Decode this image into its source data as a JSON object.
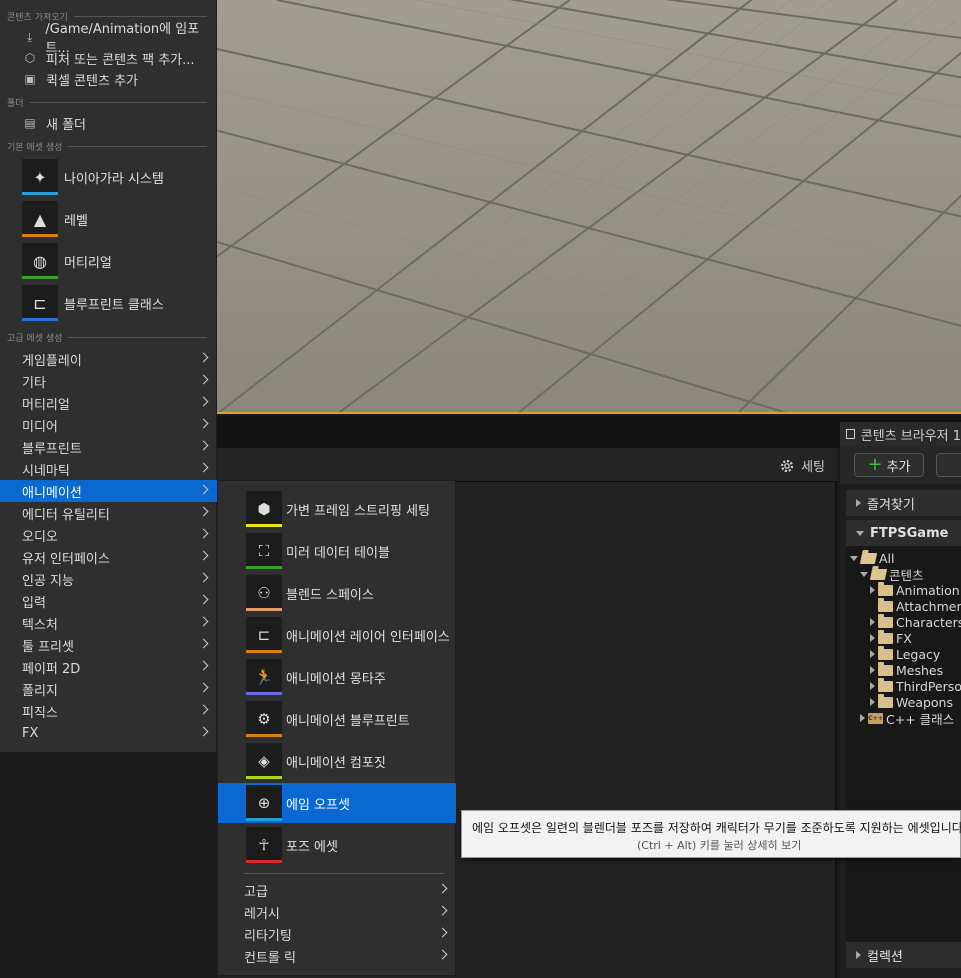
{
  "left_menu": {
    "sections": {
      "import": "콘텐츠 가져오기",
      "folder": "폴더",
      "basic": "기본 에셋 생성",
      "advanced": "고급 에셋 생성"
    },
    "import_items": [
      {
        "label": "/Game/Animation에 임포트...",
        "icon": "import-icon"
      },
      {
        "label": "피처 또는 콘텐츠 팩 추가...",
        "icon": "feature-pack-icon"
      },
      {
        "label": "퀵셀 콘텐츠 추가",
        "icon": "quixel-icon"
      }
    ],
    "folder_item": {
      "label": "새 폴더",
      "icon": "new-folder-icon"
    },
    "basic_assets": [
      {
        "label": "나이아가라 시스템",
        "icon": "niagara-icon",
        "color": "#27a0d9"
      },
      {
        "label": "레벨",
        "icon": "level-icon",
        "color": "#d97f10"
      },
      {
        "label": "머티리얼",
        "icon": "material-icon",
        "color": "#3b9f2d"
      },
      {
        "label": "블루프린트 클래스",
        "icon": "blueprint-icon",
        "color": "#2a6fd6"
      }
    ],
    "categories": [
      "게임플레이",
      "기타",
      "머티리얼",
      "미디어",
      "블루프린트",
      "시네마틱",
      "애니메이션",
      "에디터 유틸리티",
      "오디오",
      "유저 인터페이스",
      "인공 지능",
      "입력",
      "텍스처",
      "툴 프리셋",
      "페이퍼 2D",
      "폴리지",
      "피직스",
      "FX"
    ],
    "active_category": "애니메이션"
  },
  "submenu": {
    "assets": [
      {
        "label": "가변 프레임 스트리핑 세팅",
        "icon": "cube-icon",
        "color": "#e6e61a"
      },
      {
        "label": "미러 데이터 테이블",
        "icon": "mirror-icon",
        "color": "#3b9f2d"
      },
      {
        "label": "블렌드 스페이스",
        "icon": "blend-space-icon",
        "color": "#e89a6b"
      },
      {
        "label": "애니메이션 레이어 인터페이스",
        "icon": "layer-interface-icon",
        "color": "#d97f10"
      },
      {
        "label": "애니메이션 몽타주",
        "icon": "montage-icon",
        "color": "#6a6ae8"
      },
      {
        "label": "애니메이션 블루프린트",
        "icon": "anim-blueprint-icon",
        "color": "#d97f10"
      },
      {
        "label": "애니메이션 컴포짓",
        "icon": "composite-icon",
        "color": "#a8d81a"
      },
      {
        "label": "에임 오프셋",
        "icon": "aim-offset-icon",
        "color": "#27a0d9"
      },
      {
        "label": "포즈 에셋",
        "icon": "pose-asset-icon",
        "color": "#d62a2a"
      }
    ],
    "active_asset": "에임 오프셋",
    "categories": [
      "고급",
      "레거시",
      "리타기팅",
      "컨트롤 릭"
    ]
  },
  "tooltip": {
    "text": "에임 오프셋은 일련의 블렌더블 포즈를 저장하여 캐릭터가 무기를 조준하도록 지원하는 에셋입니다.",
    "hint": "(Ctrl + Alt) 키를 눌러 상세히 보기"
  },
  "details": {
    "settings_label": "세팅"
  },
  "content_browser": {
    "tab_label": "콘텐츠 브라우저 1",
    "add_label": "추가",
    "favorites_label": "즐겨찾기",
    "project_label": "FTPSGame",
    "collections_label": "컬렉션",
    "tree": [
      {
        "label": "All",
        "level": 0,
        "expanded": true,
        "type": "folder-open"
      },
      {
        "label": "콘텐츠",
        "level": 1,
        "expanded": true,
        "type": "folder-open"
      },
      {
        "label": "Animation",
        "level": 2,
        "expanded": false,
        "type": "folder"
      },
      {
        "label": "Attachments",
        "level": 2,
        "expanded": null,
        "type": "folder"
      },
      {
        "label": "Characters",
        "level": 2,
        "expanded": false,
        "type": "folder"
      },
      {
        "label": "FX",
        "level": 2,
        "expanded": false,
        "type": "folder"
      },
      {
        "label": "Legacy",
        "level": 2,
        "expanded": false,
        "type": "folder"
      },
      {
        "label": "Meshes",
        "level": 2,
        "expanded": false,
        "type": "folder"
      },
      {
        "label": "ThirdPerson",
        "level": 2,
        "expanded": false,
        "type": "folder"
      },
      {
        "label": "Weapons",
        "level": 2,
        "expanded": false,
        "type": "folder"
      },
      {
        "label": "C++ 클래스",
        "level": 1,
        "expanded": false,
        "type": "cpp"
      }
    ]
  }
}
